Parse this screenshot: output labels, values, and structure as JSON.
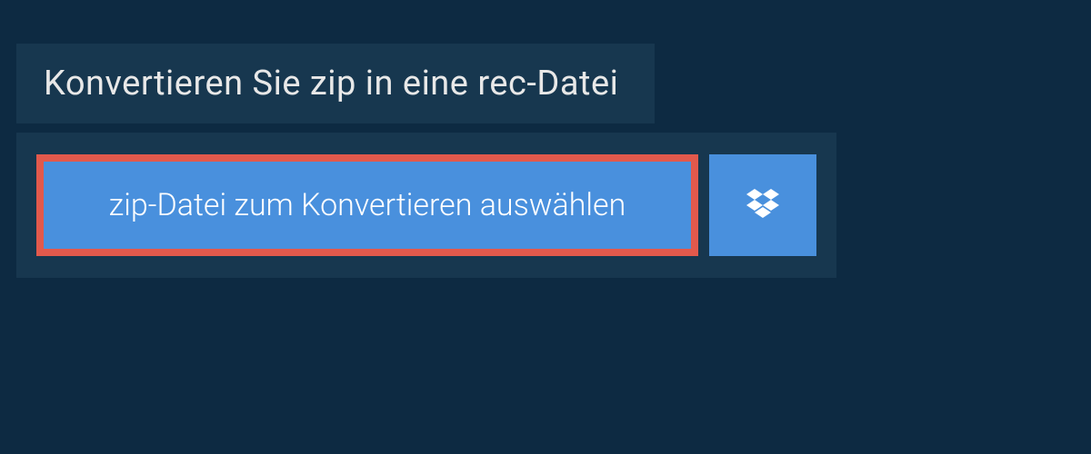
{
  "header": {
    "title": "Konvertieren Sie zip in eine rec-Datei"
  },
  "actions": {
    "select_file_label": "zip-Datei zum Konvertieren auswählen"
  },
  "colors": {
    "background": "#0d2a42",
    "panel": "#17374f",
    "button": "#4990dd",
    "button_border": "#e2594c"
  }
}
